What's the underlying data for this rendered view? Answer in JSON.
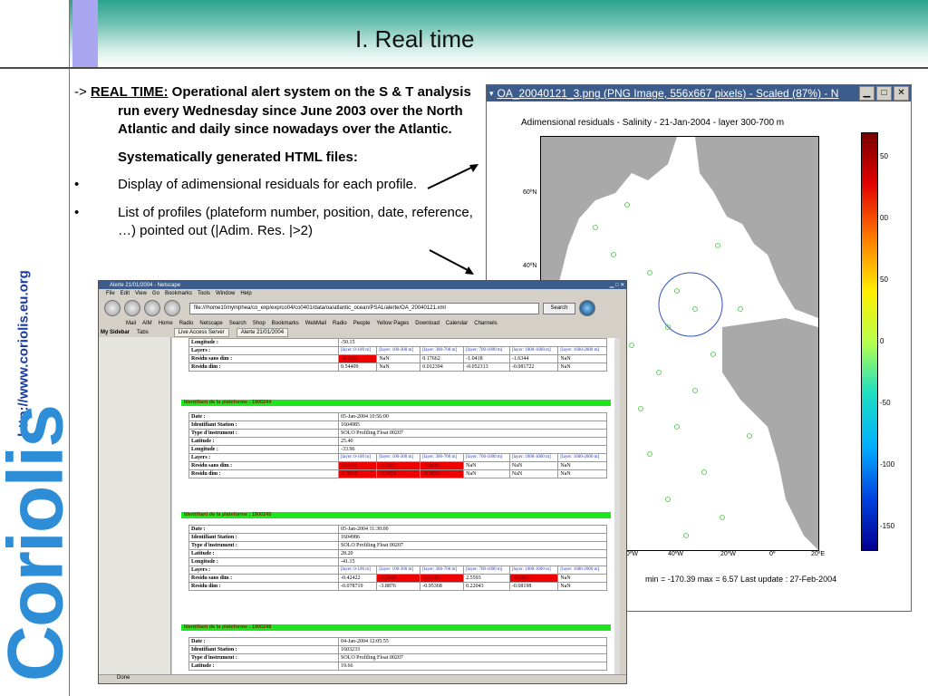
{
  "slide": {
    "title": "I. Real time",
    "side_url": "http://www.coriolis.eu.org",
    "brand": "Coriolis",
    "colors": {
      "header_teal": "#2aa38e",
      "stripe_lavender": "#aaa6f0",
      "brand_blue": "#2d8ed7",
      "url_blue": "#1a3aa6"
    }
  },
  "bullets": {
    "p1_prefix": "->",
    "p1_label": "REAL TIME:",
    "p1_text": "Operational alert system on the S & T analysis run every Wednesday since June 2003 over the North Atlantic and daily since nowadays over the Atlantic.",
    "p2": "Systematically generated HTML files:",
    "b1_mark": "•",
    "b1": "Display of adimensional residuals for each profile.",
    "b2_mark": "•",
    "b2": "List of profiles (plateform number, position, date, reference, …) pointed out (|Adim. Res. |>2)"
  },
  "image_window": {
    "title": "OA_20040121_3.png (PNG Image, 556x667 pixels) - Scaled (87%) - N",
    "chart_title": "Adimensional residuals - Salinity - 21-Jan-2004 - layer 300-700 m",
    "colorbar_ticks": [
      "50",
      "00",
      "50",
      "0",
      "-50",
      "-100",
      "-150"
    ],
    "lat_labels": [
      "60ºN",
      "40ºN"
    ],
    "lon_labels": [
      "60ºW",
      "40ºW",
      "20ºW",
      "0º",
      "20ºE"
    ],
    "stats": "min = -170.39  max = 6.57  Last update : 27-Feb-2004"
  },
  "browser": {
    "title": "Alerte 21/01/2004 - Netscape",
    "menu": [
      "File",
      "Edit",
      "View",
      "Go",
      "Bookmarks",
      "Tools",
      "Window",
      "Help"
    ],
    "url": "file:///home10/nymphea/co_exp/exp/co04/co0401/data/oa/atlantic_ocean/PSAL/alerte/OA_20040121.xml",
    "search_label": "Search",
    "personal": [
      "Mail",
      "AIM",
      "Home",
      "Radio",
      "Netscape",
      "Search",
      "Shop",
      "Bookmarks",
      "WebMail",
      "Radio",
      "People",
      "Yellow Pages",
      "Download",
      "Calendar",
      "Channels"
    ],
    "sidebar_label": "My Sidebar",
    "tabs_label": "Tabs",
    "tab1": "Live Access Server",
    "tab2": "Alerte 21/01/2004",
    "status": "Done",
    "top_table": {
      "longitude_label": "Longitude :",
      "longitude": "-50.15",
      "layers_label": "Layers :",
      "layers": [
        "[layer: 0-100 m]",
        "[layer: 100-300 m]",
        "[layer: 300-700 m]",
        "[layer: 700-1000 m]",
        "[layer: 1000-1600 m]",
        "[layer: 1600-2000 m]"
      ],
      "res_sans_label": "Residu sans dim :",
      "res_sans": [
        "-4.2196",
        "NaN",
        "0.17662",
        "-1.0418",
        "-1.6344",
        "NaN"
      ],
      "res_dim_label": "Residu dim :",
      "res_dim": [
        "0.54409",
        "NaN",
        "0.012394",
        "-0.052313",
        "-0.081722",
        "NaN"
      ]
    },
    "platforms": [
      {
        "header": "Identifiant de la plateforme : 1900244",
        "date": "05-Jan-2004 10:56:00",
        "station": "1604985",
        "instrument": "SOLO Profiling Float 00207",
        "latitude": "25.40",
        "longitude": "-33.96",
        "res_sans": [
          "-0.0455",
          "-6.7837",
          "-7.8836",
          "NaN",
          "NaN",
          "NaN"
        ],
        "res_dim": [
          "-1.9018",
          "-5.3474",
          "-4.3654",
          "NaN",
          "NaN",
          "NaN"
        ]
      },
      {
        "header": "Identifiant de la plateforme : 1900245",
        "date": "05-Jan-2004 11:30:00",
        "station": "1604986",
        "instrument": "SOLO Profiling Float 00207",
        "latitude": "28.20",
        "longitude": "-41.15",
        "res_sans": [
          "-0.42422",
          "-4.3568",
          "-5.1726",
          "2.5593",
          "-4.3015",
          "NaN"
        ],
        "res_dim": [
          "-0.078719",
          "-3.8876",
          "-0.95368",
          "0.22043",
          "-0.68198",
          "NaN"
        ]
      },
      {
        "header": "Identifiant de la plateforme : 1900248",
        "date": "04-Jan-2004 12:05:55",
        "station": "1603233",
        "instrument": "SOLO Profiling Float 00207",
        "latitude": "19.66"
      }
    ],
    "labels": {
      "date": "Date :",
      "station": "Identifiant Station :",
      "instrument": "Type d'instrument :",
      "latitude": "Latitude :",
      "longitude": "Longitude :",
      "layers": "Layers :",
      "res_sans": "Residu sans dim :",
      "res_dim": "Residu dim :"
    }
  }
}
